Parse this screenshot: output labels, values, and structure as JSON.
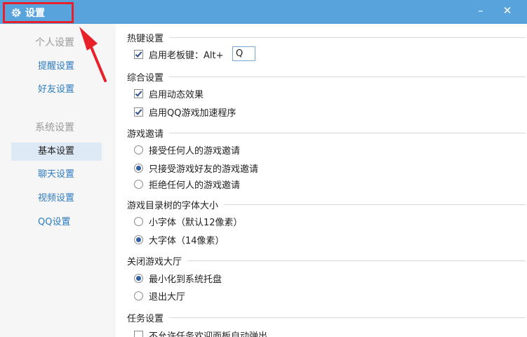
{
  "window": {
    "title": "设置",
    "minimize_label": "–",
    "close_label": "✕",
    "icons": {
      "title": "gear-icon",
      "minimize": "minimize-icon",
      "close": "close-icon"
    },
    "colors": {
      "titlebar": "#58a3dc",
      "highlight_box": "#e8202a",
      "arrow": "#e8202a"
    }
  },
  "sidebar": {
    "groups": [
      {
        "label": "个人设置",
        "items": [
          "提醒设置",
          "好友设置"
        ]
      },
      {
        "label": "系统设置",
        "items": [
          "基本设置",
          "聊天设置",
          "视频设置",
          "QQ设置"
        ]
      }
    ],
    "active_item": "基本设置"
  },
  "sections": {
    "hotkey": {
      "title": "热键设置",
      "boss_key": {
        "label": "启用老板键：Alt+",
        "checked": true,
        "value": "Q"
      }
    },
    "general": {
      "title": "综合设置",
      "dynamic_effects": {
        "label": "启用动态效果",
        "checked": true
      },
      "qq_game_accel": {
        "label": "启用QQ游戏加速程序",
        "checked": true
      }
    },
    "invite": {
      "title": "游戏邀请",
      "options": [
        "接受任何人的游戏邀请",
        "只接受游戏好友的游戏邀请",
        "拒绝任何人的游戏邀请"
      ],
      "selected": "只接受游戏好友的游戏邀请"
    },
    "font_size": {
      "title": "游戏目录树的字体大小",
      "options": [
        "小字体（默认12像素）",
        "大字体（14像素）"
      ],
      "selected": "大字体（14像素）"
    },
    "close_hall": {
      "title": "关闭游戏大厅",
      "options": [
        "最小化到系统托盘",
        "退出大厅"
      ],
      "selected": "最小化到系统托盘"
    },
    "task": {
      "title": "任务设置",
      "no_popup": {
        "label": "不允许任务欢迎面板自动弹出",
        "checked": false
      }
    }
  }
}
